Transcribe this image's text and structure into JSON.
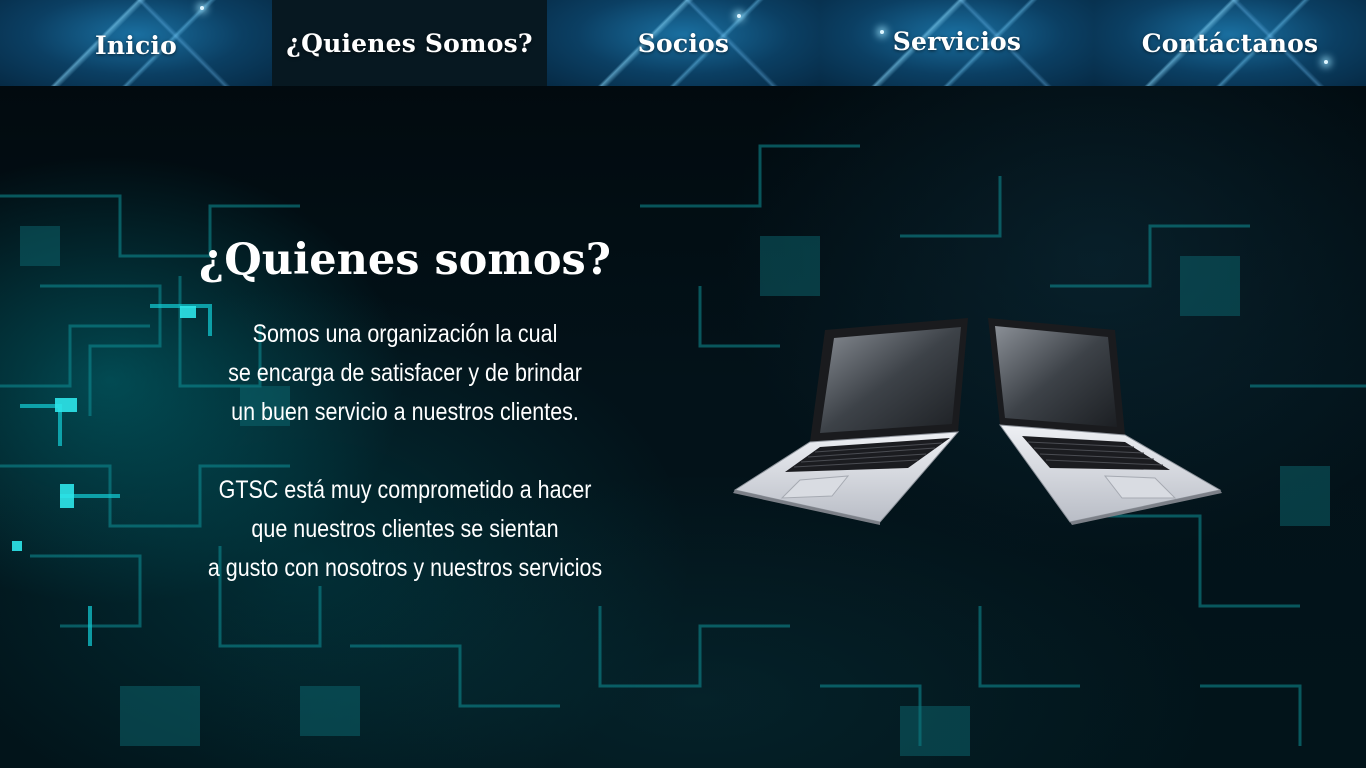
{
  "nav": {
    "items": [
      {
        "label": "Inicio",
        "active": false
      },
      {
        "label": "¿Quienes Somos?",
        "active": true
      },
      {
        "label": "Socios",
        "active": false
      },
      {
        "label": "Servicios",
        "active": false
      },
      {
        "label": "Contáctanos",
        "active": false
      }
    ]
  },
  "about": {
    "title": "¿Quienes somos?",
    "paragraph1": {
      "lines": [
        "Somos una organización la cual",
        "se encarga de satisfacer y de brindar",
        "un buen servicio a nuestros clientes."
      ]
    },
    "paragraph2": {
      "lines": [
        "GTSC está muy comprometido a hacer",
        "que nuestros clientes se sientan",
        "a gusto con nosotros y nuestros servicios"
      ]
    }
  },
  "colors": {
    "nav_blue": "#0b3f63",
    "nav_active": "#071821",
    "background": "#020a0f",
    "circuit_glow": "#00c8d2",
    "text": "#ffffff"
  },
  "images": {
    "laptops": "two-laptops-illustration"
  }
}
